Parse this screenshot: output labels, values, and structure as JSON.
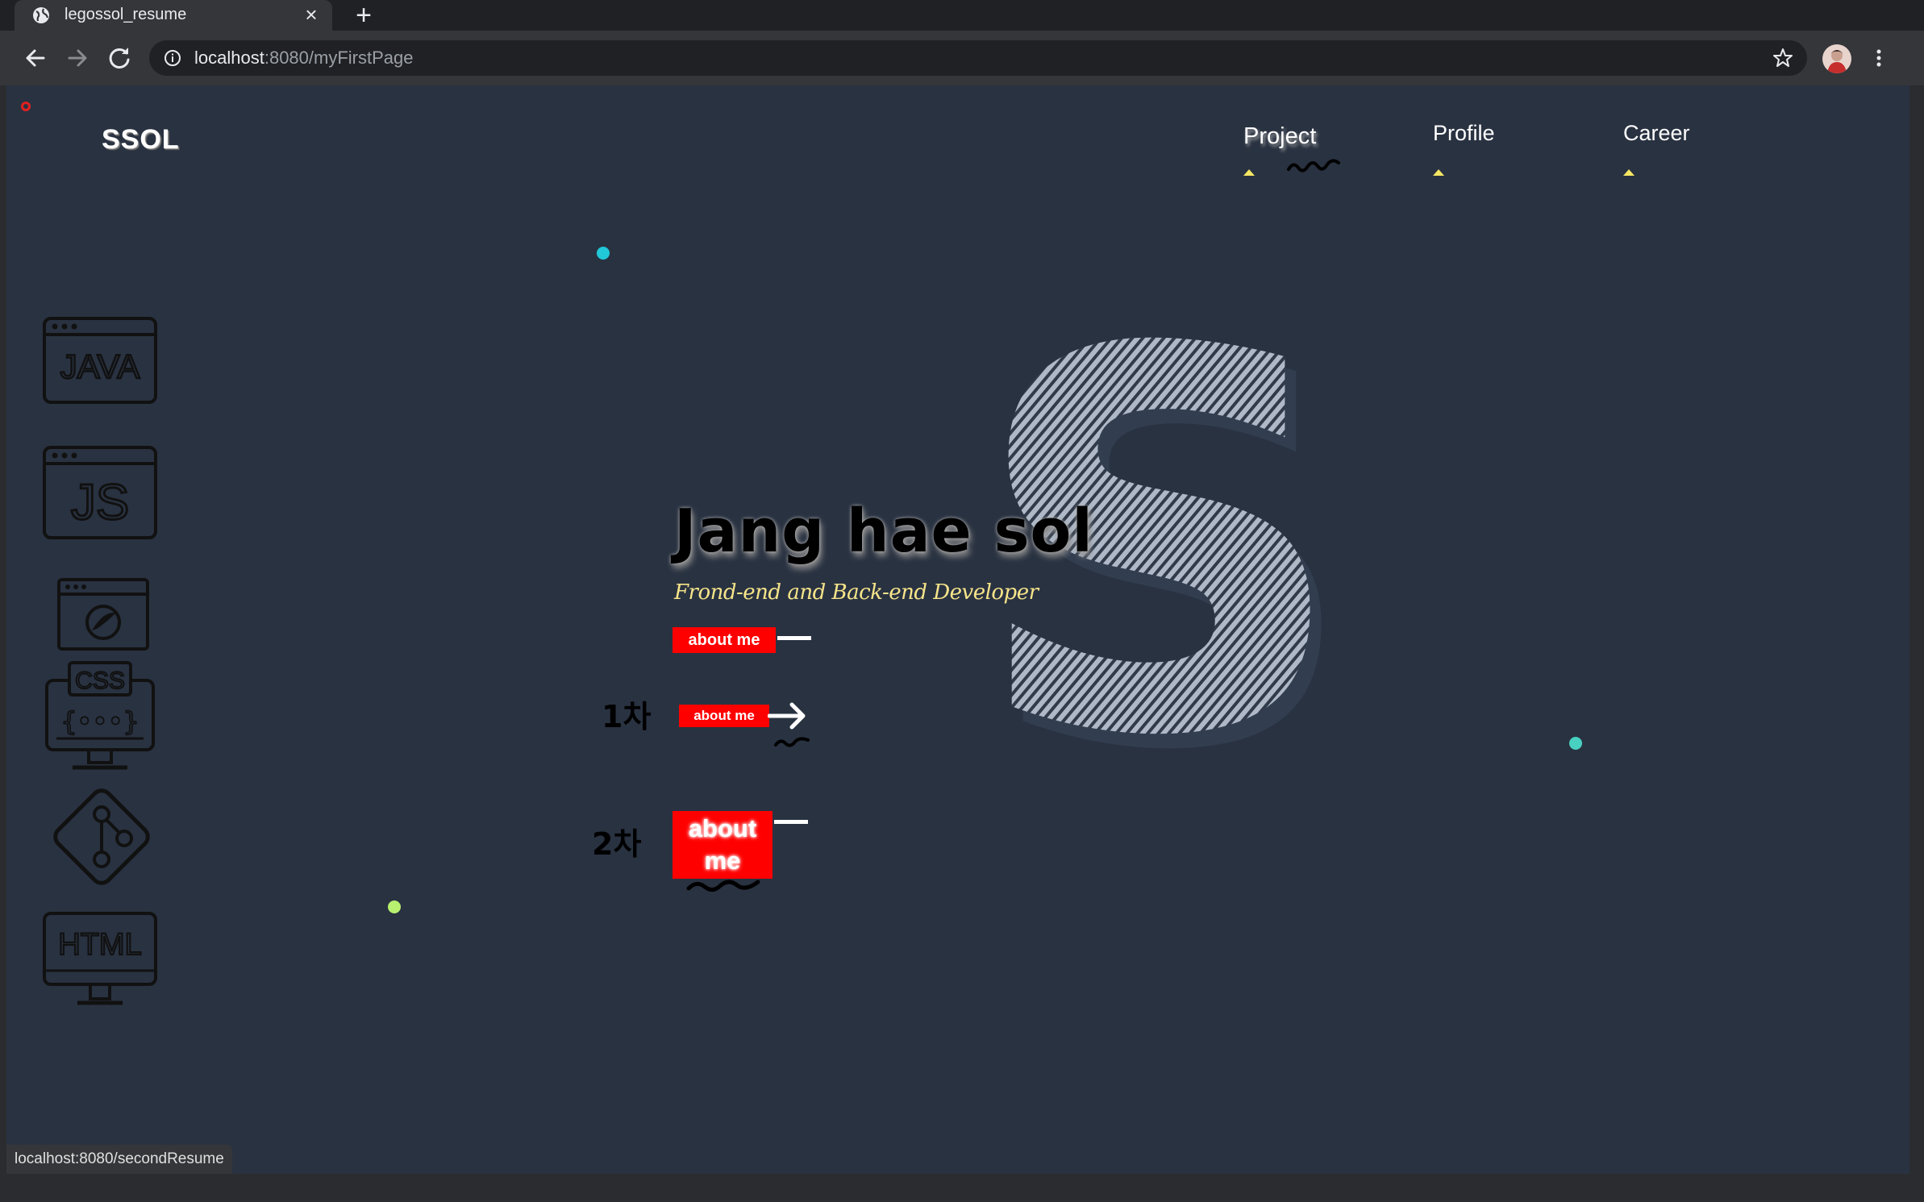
{
  "browser": {
    "tab_title": "legossol_resume",
    "url_host": "localhost",
    "url_path": ":8080/myFirstPage",
    "status_url": "localhost:8080/secondResume"
  },
  "site": {
    "logo": "SSOL",
    "nav": [
      {
        "label": "Project"
      },
      {
        "label": "Profile"
      },
      {
        "label": "Career"
      }
    ],
    "hero": {
      "name": "Jang hae sol",
      "subtitle": "Frond-end and Back-end Developer",
      "button_label": "about me"
    },
    "skills": [
      "JAVA",
      "JS",
      "CSS",
      "HTML"
    ],
    "annotations": [
      "1차",
      "2차"
    ]
  },
  "colors": {
    "page_bg": "#293241",
    "button_red": "#ff0000",
    "accent_yellow": "#f5e663",
    "subtitle_yellow": "#f6e48a"
  }
}
